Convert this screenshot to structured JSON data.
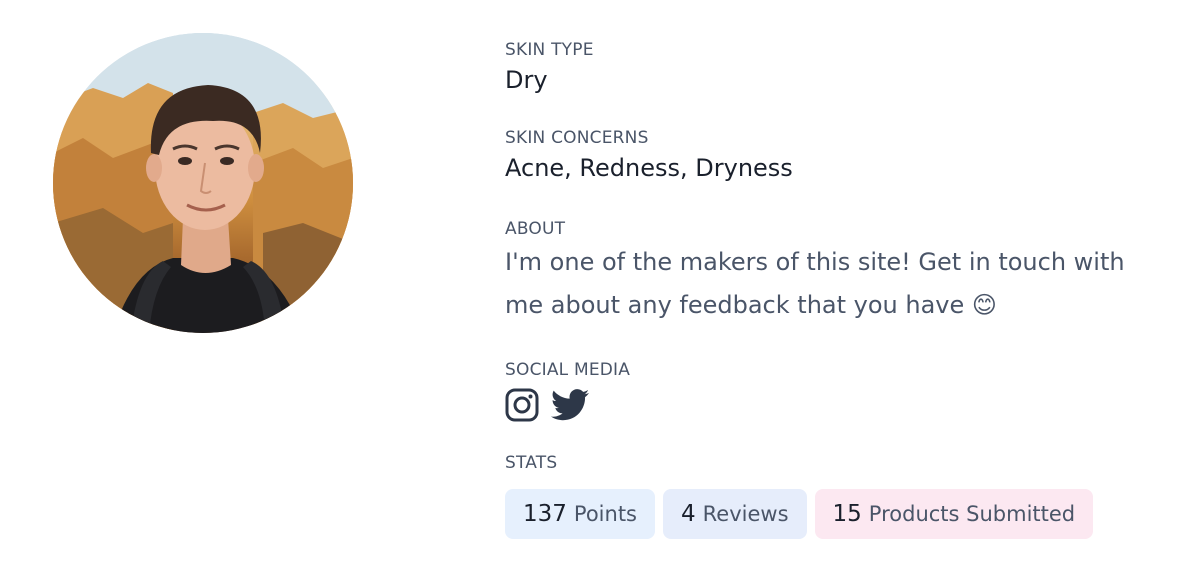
{
  "profile": {
    "avatar_icon": "profile-photo"
  },
  "skin_type": {
    "label": "SKIN TYPE",
    "value": "Dry"
  },
  "skin_concerns": {
    "label": "SKIN CONCERNS",
    "value": "Acne, Redness, Dryness"
  },
  "about": {
    "label": "ABOUT",
    "text": "I'm one of the makers of this site! Get in touch with me about any feedback that you have 😊"
  },
  "social_media": {
    "label": "SOCIAL MEDIA",
    "icons": [
      "instagram-icon",
      "twitter-icon"
    ],
    "icon_color": "#2d3748"
  },
  "stats": {
    "label": "STATS",
    "items": [
      {
        "number": "137",
        "label": "Points",
        "color": "#e6f0fd"
      },
      {
        "number": "4",
        "label": "Reviews",
        "color": "#e6edfb"
      },
      {
        "number": "15",
        "label": "Products Submitted",
        "color": "#fce8f1"
      }
    ]
  }
}
